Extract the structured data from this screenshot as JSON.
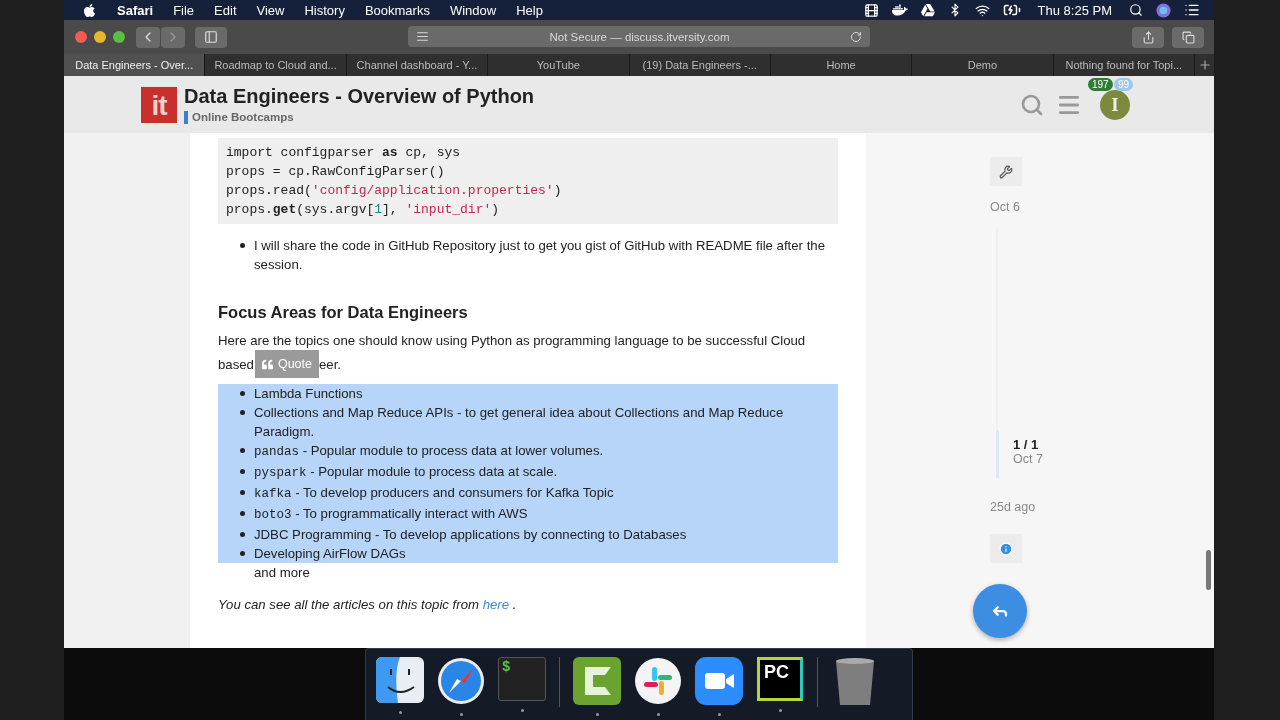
{
  "menu_bar": {
    "app": "Safari",
    "menus": [
      "File",
      "Edit",
      "View",
      "History",
      "Bookmarks",
      "Window",
      "Help"
    ],
    "clock": "Thu 8:25 PM"
  },
  "browser": {
    "address": "Not Secure — discuss.itversity.com",
    "tabs": [
      {
        "title": "Data Engineers - Over...",
        "selected": true
      },
      {
        "title": "Roadmap to Cloud and...",
        "selected": false
      },
      {
        "title": "Channel dashboard - Y...",
        "selected": false
      },
      {
        "title": "YouTube",
        "selected": false
      },
      {
        "title": "(19) Data Engineers -...",
        "selected": false
      },
      {
        "title": "Home",
        "selected": false
      },
      {
        "title": "Demo",
        "selected": false
      },
      {
        "title": "Nothing found for Topi...",
        "selected": false
      }
    ]
  },
  "site_header": {
    "logo_text": "it",
    "title": "Data Engineers - Overview of Python",
    "category": "Online Bootcamps",
    "notifications": "197",
    "messages": "99",
    "avatar_letter": "I"
  },
  "post": {
    "code_lines": [
      [
        {
          "kind": "plain",
          "text": "import configparser "
        },
        {
          "kind": "keyword",
          "text": "as"
        },
        {
          "kind": "plain",
          "text": " cp, sys"
        }
      ],
      [
        {
          "kind": "plain",
          "text": "props = cp.RawConfigParser()"
        }
      ],
      [
        {
          "kind": "plain",
          "text": "props.read("
        },
        {
          "kind": "string",
          "text": "'config/application.properties'"
        },
        {
          "kind": "plain",
          "text": ")"
        }
      ],
      [
        {
          "kind": "plain",
          "text": "props."
        },
        {
          "kind": "keyword",
          "text": "get"
        },
        {
          "kind": "plain",
          "text": "(sys.argv["
        },
        {
          "kind": "number",
          "text": "1"
        },
        {
          "kind": "plain",
          "text": "], "
        },
        {
          "kind": "string",
          "text": "'input_dir'"
        },
        {
          "kind": "plain",
          "text": ")"
        }
      ]
    ],
    "note": "I will share the code in GitHub Repository just to get you gist of GitHub with README file after the session.",
    "heading": "Focus Areas for Data Engineers",
    "intro_line_1": "Here are the topics one should know using Python as programming language to be successful Cloud",
    "intro_line_2_start": "based",
    "quote_button": "Quote",
    "intro_line_2_end": "eer.",
    "topics": [
      {
        "text": "Lambda Functions",
        "selected": true
      },
      {
        "text": "Collections and Map Reduce APIs - to get general idea about Collections and Map Reduce Paradigm.",
        "selected": true
      },
      {
        "code": "pandas",
        "text": " - Popular module to process data at lower volumes.",
        "selected": true
      },
      {
        "code": "pyspark",
        "text": " - Popular module to process data at scale.",
        "selected": true
      },
      {
        "code": "kafka",
        "text": " - To develop producers and consumers for Kafka Topic",
        "selected": true
      },
      {
        "code": "boto3",
        "text": " - To programmatically interact with AWS",
        "selected": true
      },
      {
        "text": "JDBC Programming - To develop applications by connecting to Databases",
        "selected": true
      },
      {
        "text": "Developing AirFlow DAGs",
        "selected": true
      }
    ],
    "more": "and more",
    "footer_text": "You can see all the articles on this topic from ",
    "footer_link": "here",
    "footer_end": " ."
  },
  "timeline": {
    "start_date": "Oct 6",
    "position": "1 / 1",
    "position_date": "Oct 7",
    "last_activity": "25d ago"
  },
  "dock": [
    {
      "kind": "finder",
      "running": true
    },
    {
      "kind": "safari",
      "running": true
    },
    {
      "kind": "terminal",
      "label": "$",
      "running": true
    },
    {
      "kind": "separator"
    },
    {
      "kind": "camtasia",
      "running": true
    },
    {
      "kind": "slack",
      "running": true
    },
    {
      "kind": "zoom",
      "running": true
    },
    {
      "kind": "pycharm",
      "label": "PC",
      "running": true
    },
    {
      "kind": "separator"
    },
    {
      "kind": "trash"
    }
  ]
}
